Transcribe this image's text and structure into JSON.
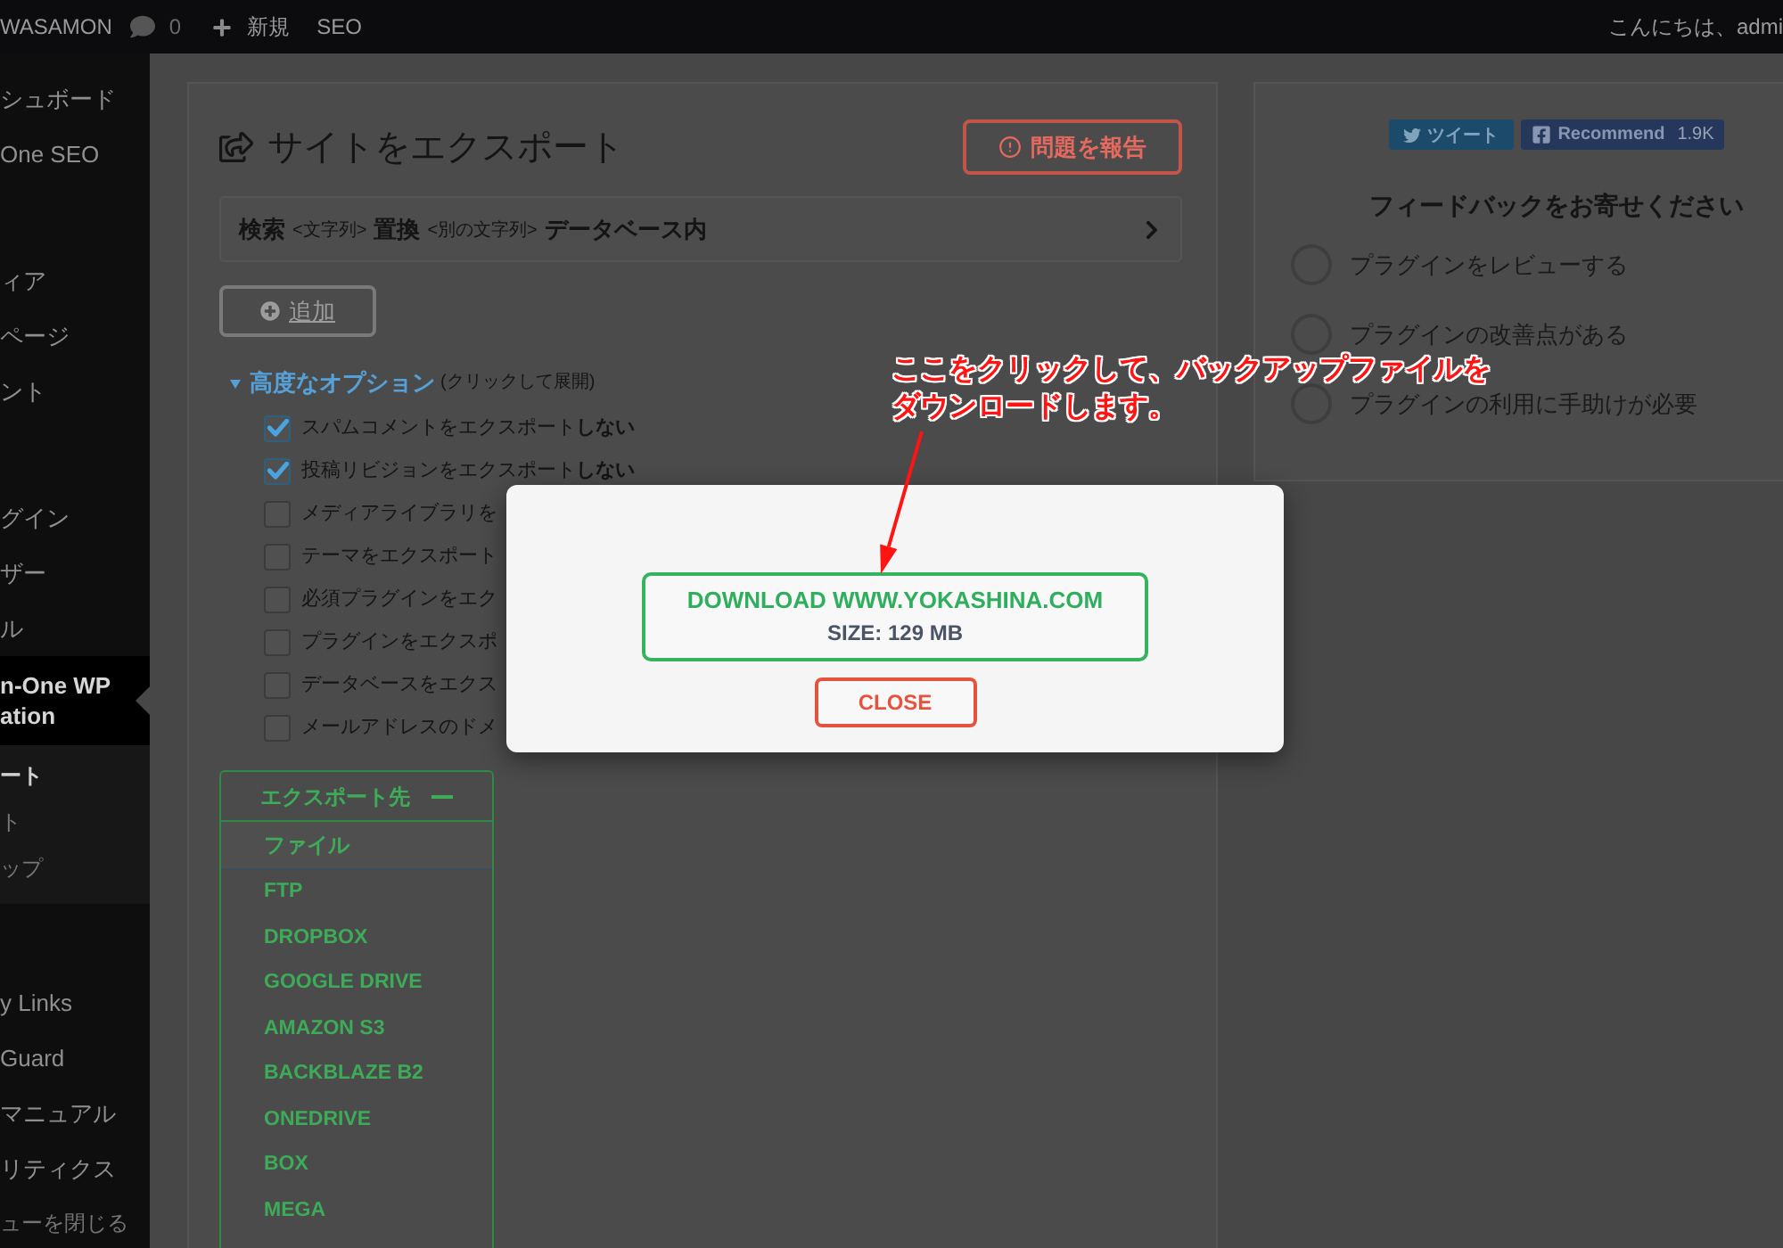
{
  "admin_bar": {
    "site_name": "WASAMON",
    "comment_count": "0",
    "new_label": "新規",
    "seo_label": "SEO",
    "greeting": "こんにちは、admi"
  },
  "sidebar": {
    "groups": [
      {
        "items": [
          {
            "label": "シュボード",
            "selected": false
          },
          {
            "label": "One SEO",
            "selected": false
          }
        ]
      },
      {
        "items": [
          {
            "label": "ィア",
            "selected": false
          },
          {
            "label": "ページ",
            "selected": false
          },
          {
            "label": "ント",
            "selected": false
          }
        ]
      },
      {
        "items": [
          {
            "label": "グイン",
            "selected": false
          },
          {
            "label": "ザー",
            "selected": false
          },
          {
            "label": "ル",
            "selected": false
          },
          {
            "label": "n-One WP\nation",
            "selected": true,
            "children": [
              {
                "label": "ート",
                "selected": true
              },
              {
                "label": "ト",
                "selected": false
              },
              {
                "label": "ップ",
                "selected": false
              }
            ]
          }
        ]
      },
      {
        "items": [
          {
            "label": "y Links",
            "selected": false
          },
          {
            "label": "Guard",
            "selected": false
          },
          {
            "label": "マニュアル",
            "selected": false
          },
          {
            "label": "リティクス",
            "selected": false
          }
        ]
      }
    ],
    "collapse_label": "ューを閉じる"
  },
  "export_panel": {
    "title": "サイトをエクスポート",
    "report_button": "問題を報告",
    "find_replace": {
      "parts": [
        {
          "kind": "keyword",
          "text": "検索"
        },
        {
          "kind": "placeholder",
          "text": "<文字列>"
        },
        {
          "kind": "keyword",
          "text": "置換"
        },
        {
          "kind": "placeholder",
          "text": "<別の文字列>"
        },
        {
          "kind": "keyword",
          "text": "データベース内"
        }
      ]
    },
    "add_button": "追加",
    "advanced_options": {
      "label": "高度なオプション",
      "hint": "(クリックして展開)",
      "expanded": true,
      "options": [
        {
          "label": "スパムコメントをエクスポート**しない**",
          "checked": true
        },
        {
          "label": "投稿リビジョンをエクスポート**しない**",
          "checked": true
        },
        {
          "label": "メディアライブラリを",
          "checked": false
        },
        {
          "label": "テーマをエクスポート",
          "checked": false
        },
        {
          "label": "必須プラグインをエク",
          "checked": false
        },
        {
          "label": "プラグインをエクスポ",
          "checked": false
        },
        {
          "label": "データベースをエクス",
          "checked": false
        },
        {
          "label": "メールアドレスのドメ",
          "checked": false
        }
      ]
    },
    "export_to": {
      "title": "エクスポート先",
      "expanded": true,
      "items": [
        {
          "label": "ファイル",
          "selected": true
        },
        {
          "label": "FTP",
          "selected": false
        },
        {
          "label": "DROPBOX",
          "selected": false
        },
        {
          "label": "GOOGLE DRIVE",
          "selected": false
        },
        {
          "label": "AMAZON S3",
          "selected": false
        },
        {
          "label": "BACKBLAZE B2",
          "selected": false
        },
        {
          "label": "ONEDRIVE",
          "selected": false
        },
        {
          "label": "BOX",
          "selected": false
        },
        {
          "label": "MEGA",
          "selected": false
        }
      ]
    }
  },
  "side_panel": {
    "tweet_label": "ツイート",
    "recommend_label": "Recommend",
    "recommend_count": "1.9K",
    "feedback_title": "フィードバックをお寄せください",
    "feedback_options": [
      {
        "label": "プラグインをレビューする",
        "selected": false
      },
      {
        "label": "プラグインの改善点がある",
        "selected": false
      },
      {
        "label": "プラグインの利用に手助けが必要",
        "selected": false
      }
    ]
  },
  "modal": {
    "download_title": "DOWNLOAD WWW.YOKASHINA.COM",
    "download_size": "SIZE: 129 MB",
    "close_label": "CLOSE"
  },
  "annotation": {
    "lines": [
      "ここをクリックして、バックアップファイルを",
      "ダウンロードします。"
    ]
  }
}
